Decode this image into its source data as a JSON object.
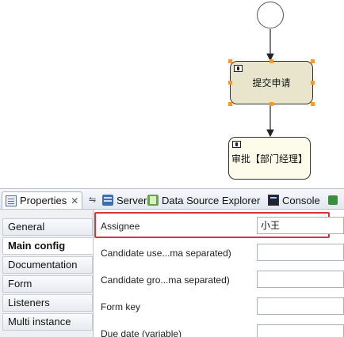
{
  "diagram": {
    "tasks": [
      {
        "label": "提交申请",
        "selected": true
      },
      {
        "label": "审批【部门经理】",
        "selected": false
      }
    ]
  },
  "tabs": [
    {
      "label": "Properties",
      "icon": "properties-icon",
      "active": true,
      "closable": true
    },
    {
      "label": "Servers",
      "icon": "servers-icon",
      "active": false
    },
    {
      "label": "Data Source Explorer",
      "icon": "data-source-explorer-icon",
      "active": false
    },
    {
      "label": "Console",
      "icon": "console-icon",
      "active": false
    },
    {
      "label": "",
      "icon": "progress-icon",
      "active": false
    }
  ],
  "sidebar": {
    "items": [
      {
        "label": "General"
      },
      {
        "label": "Main config",
        "active": true
      },
      {
        "label": "Documentation"
      },
      {
        "label": "Form"
      },
      {
        "label": "Listeners"
      },
      {
        "label": "Multi instance"
      }
    ]
  },
  "fields": [
    {
      "label": "Assignee",
      "value": "小王"
    },
    {
      "label": "Candidate use...ma separated)",
      "value": ""
    },
    {
      "label": "Candidate gro...ma separated)",
      "value": ""
    },
    {
      "label": "Form key",
      "value": ""
    },
    {
      "label": "Due date (variable)",
      "value": ""
    }
  ],
  "colors": {
    "selected_task_fill": "#e9e5cc",
    "task_fill": "#fdfbe9",
    "selection_handle": "#f29b35",
    "highlight_border": "#d9343a"
  }
}
